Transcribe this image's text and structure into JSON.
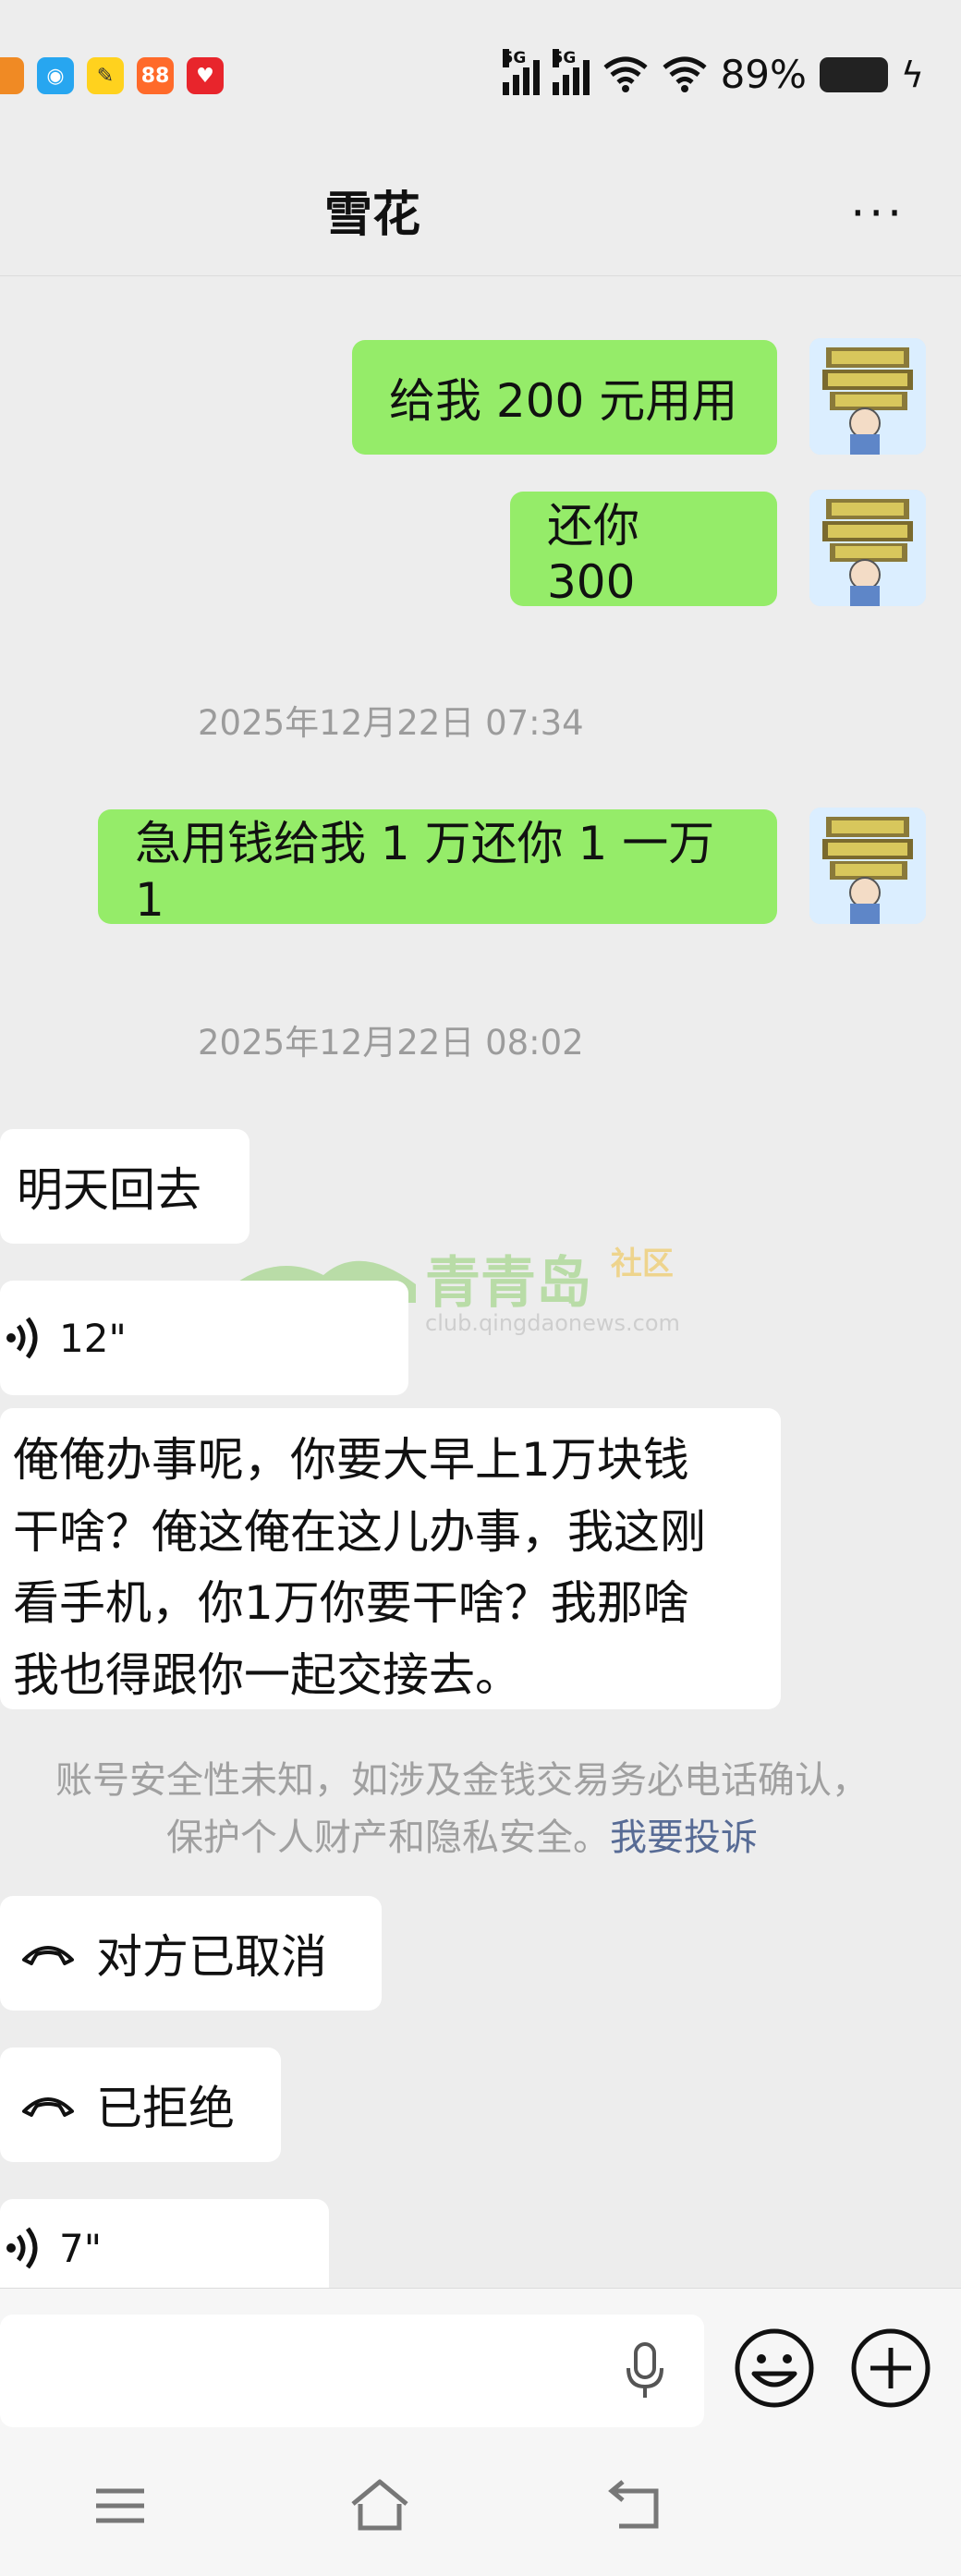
{
  "status_bar": {
    "battery": "89%",
    "signal1_label": "5G",
    "signal2_label": "5G"
  },
  "header": {
    "title": "雪花",
    "more": "···"
  },
  "messages_out": [
    {
      "text": "给我 200 元用用"
    },
    {
      "text": "还你 300"
    },
    {
      "text": "急用钱给我 1 万还你 1 一万 1"
    }
  ],
  "timestamps": [
    "2025年12月22日 07:34",
    "2025年12月22日 08:02"
  ],
  "messages_in": {
    "text1": "明天回去",
    "voice1": "12\"",
    "long_lines": [
      "俺俺办事呢，你要大早上1万块钱",
      "干啥？俺这俺在这儿办事，我这刚",
      "看手机，你1万你要干啥？我那啥",
      "我也得跟你一起交接去。"
    ],
    "call1": "对方已取消",
    "call2": "已拒绝",
    "voice2": "7\""
  },
  "notice": {
    "line1": "账号安全性未知，如涉及金钱交易务必电话确认，",
    "line2": "保护个人财产和隐私安全。",
    "link": "我要投诉"
  },
  "watermark": {
    "name": "青青岛",
    "tag": "社区",
    "url": "club.qingdaonews.com"
  },
  "colors": {
    "outgoing_bubble": "#95ec69",
    "incoming_bubble": "#ffffff",
    "background": "#ededed",
    "link": "#576b95"
  }
}
